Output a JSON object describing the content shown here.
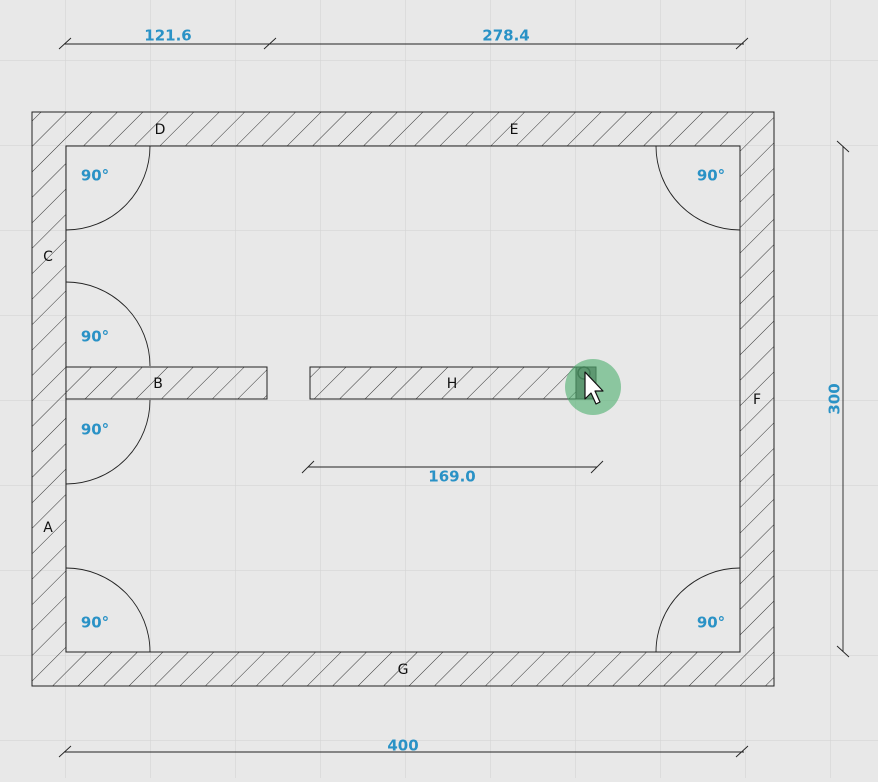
{
  "colors": {
    "background": "#e8e8e8",
    "grid": "#d4d4d4",
    "wall_stroke": "#222222",
    "hatch": "#333333",
    "accent": "#2a92c6",
    "cursor_halo": "#4caf6e"
  },
  "walls": {
    "A": "A",
    "B": "B",
    "C": "C",
    "D": "D",
    "E": "E",
    "F": "F",
    "G": "G",
    "H": "H"
  },
  "angles": {
    "top_left": "90°",
    "upper_left_mid": "90°",
    "lower_left_mid": "90°",
    "bottom_left": "90°",
    "top_right": "90°",
    "bottom_right": "90°"
  },
  "dimensions": {
    "top_left": "121.6",
    "top_right": "278.4",
    "bottom": "400",
    "right": "300",
    "wall_h": "169.0"
  },
  "icons": {
    "cursor": "mouse-pointer-icon",
    "drag_handle": "drag-handle-icon"
  }
}
